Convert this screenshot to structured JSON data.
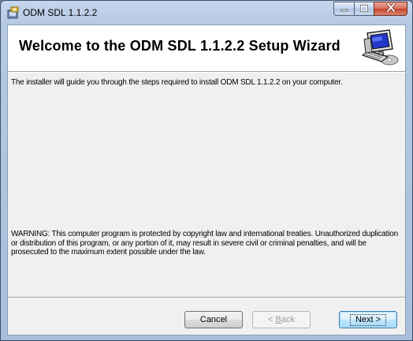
{
  "window": {
    "title": "ODM SDL 1.1.2.2"
  },
  "titlebar": {
    "app_icon": "installer-icon",
    "buttons": {
      "minimize": "minimize-icon",
      "maximize": "maximize-icon",
      "close": "close-icon"
    }
  },
  "banner": {
    "title": "Welcome to the ODM SDL 1.1.2.2 Setup Wizard",
    "icon": "computer-cd-icon"
  },
  "content": {
    "intro": "The installer will guide you through the steps required to install ODM SDL 1.1.2.2 on your computer.",
    "warning": "WARNING: This computer program is protected by copyright law and international treaties. Unauthorized duplication or distribution of this program, or any portion of it, may result in severe civil or criminal penalties, and will be prosecuted to the maximum extent possible under the law."
  },
  "buttons": {
    "cancel": "Cancel",
    "back_prefix": "< ",
    "back_mnemonic": "B",
    "back_rest": "ack",
    "next": "Next >"
  },
  "colors": {
    "titlebar": "#b6c9e3",
    "close_button": "#c4442b",
    "next_button_border": "#3c7fb1"
  }
}
